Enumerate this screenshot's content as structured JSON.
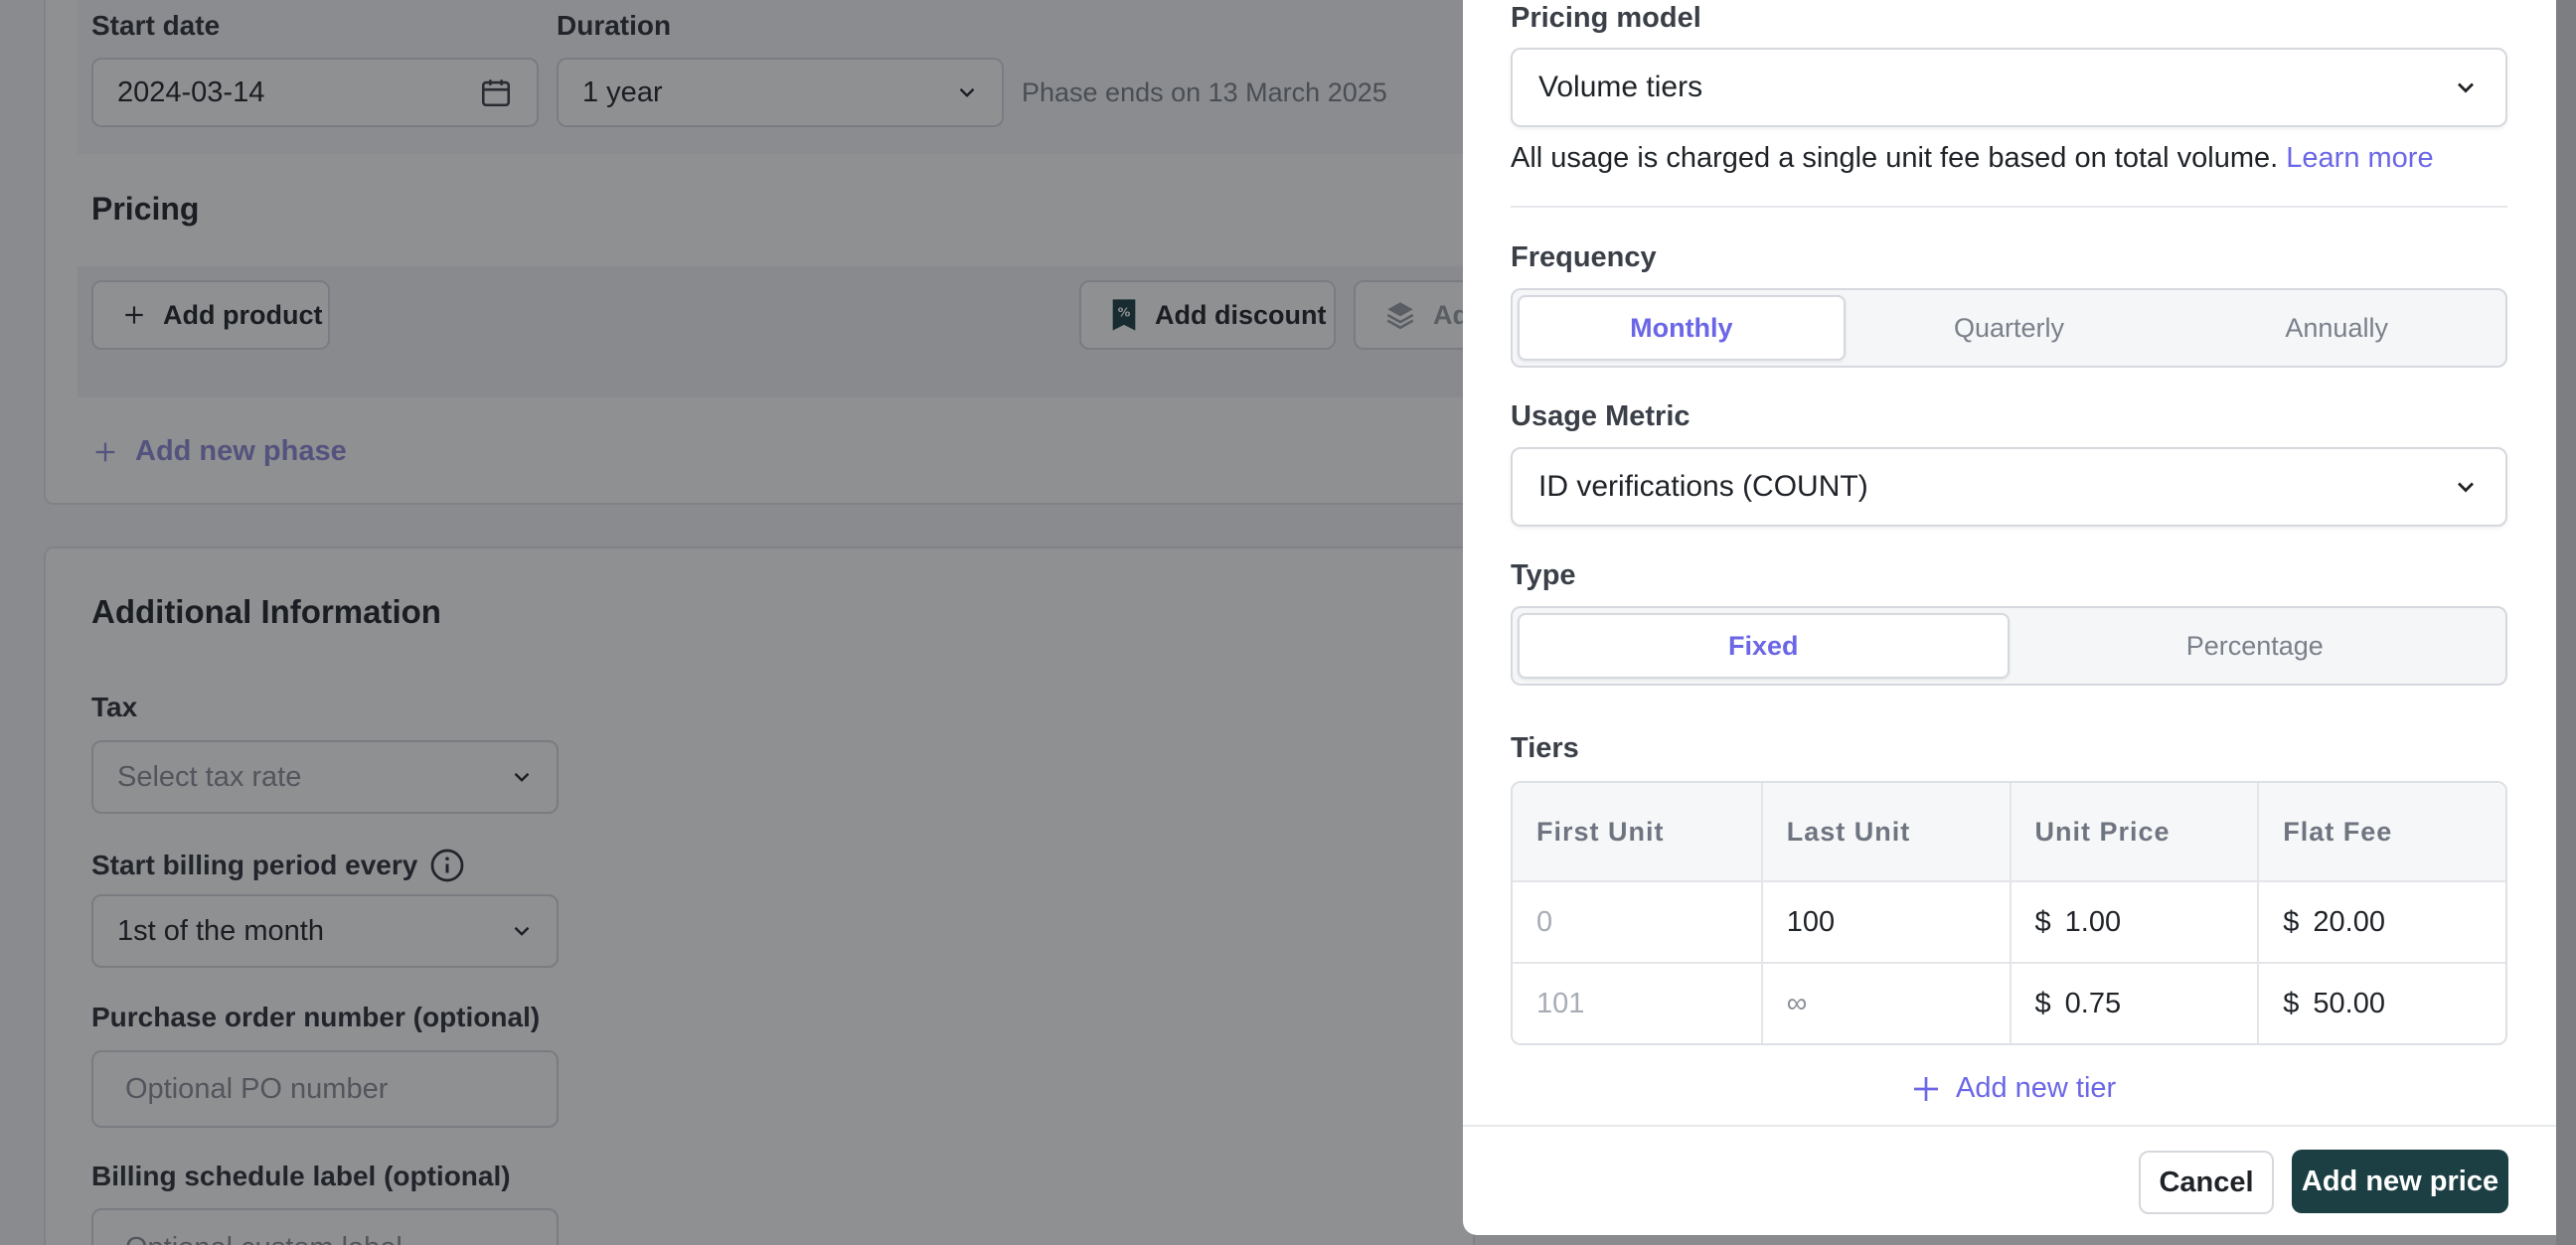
{
  "background": {
    "start_date": {
      "label": "Start date",
      "value": "2024-03-14"
    },
    "duration": {
      "label": "Duration",
      "value": "1 year"
    },
    "phase_end_text": "Phase ends on 13 March 2025",
    "pricing_title": "Pricing",
    "add_product": "Add product",
    "add_discount": "Add discount",
    "add_truncated": "Ad",
    "add_new_phase": "Add new phase",
    "additional_info_title": "Additional Information",
    "tax": {
      "label": "Tax",
      "placeholder": "Select tax rate"
    },
    "billing_period": {
      "label": "Start billing period every",
      "value": "1st of the month"
    },
    "po_number": {
      "label": "Purchase order number (optional)",
      "placeholder": "Optional PO number"
    },
    "schedule_label": {
      "label": "Billing schedule label (optional)",
      "placeholder": "Optional custom label"
    }
  },
  "panel": {
    "pricing_model": {
      "label": "Pricing model",
      "value": "Volume tiers",
      "hint": "All usage is charged a single unit fee based on total volume.",
      "learn_more": "Learn more"
    },
    "frequency": {
      "label": "Frequency",
      "options": [
        "Monthly",
        "Quarterly",
        "Annually"
      ],
      "selected": "Monthly"
    },
    "usage_metric": {
      "label": "Usage Metric",
      "value": "ID verifications (COUNT)"
    },
    "type": {
      "label": "Type",
      "options": [
        "Fixed",
        "Percentage"
      ],
      "selected": "Fixed"
    },
    "tiers": {
      "label": "Tiers",
      "columns": [
        "First Unit",
        "Last Unit",
        "Unit Price",
        "Flat Fee"
      ],
      "rows": [
        {
          "first": "0",
          "last": "100",
          "unit_price": "1.00",
          "flat_fee": "20.00"
        },
        {
          "first": "101",
          "last": "∞",
          "unit_price": "0.75",
          "flat_fee": "50.00"
        }
      ],
      "currency": "$",
      "add_tier": "Add new tier"
    },
    "cancel": "Cancel",
    "submit": "Add new price"
  },
  "colors": {
    "accent": "#6b66e6",
    "primary_button": "#1c3f43"
  }
}
